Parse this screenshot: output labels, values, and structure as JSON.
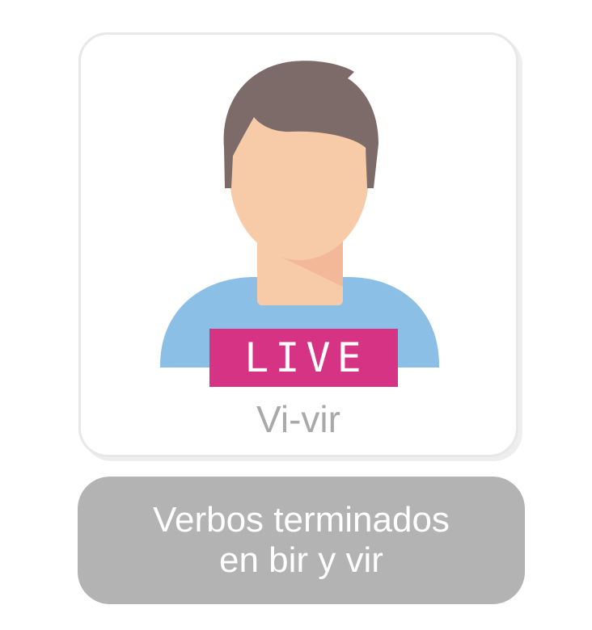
{
  "card": {
    "badge": "LIVE",
    "word": "Vi-vir",
    "icon": "man-avatar-icon",
    "colors": {
      "hair": "#7d6b69",
      "skin": "#f7cba7",
      "skin_shadow": "#f2b897",
      "shirt": "#8bbfe5",
      "badge": "#d63384",
      "word_text": "#a9a9a9"
    }
  },
  "caption": {
    "line1": "Verbos terminados",
    "line2": "en bir y vir",
    "background": "#b3b3b3"
  }
}
